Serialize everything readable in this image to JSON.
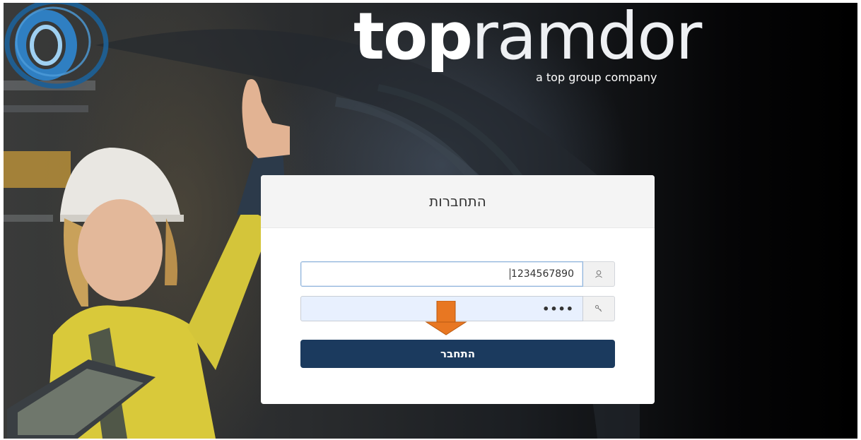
{
  "brand": {
    "name_bold": "top",
    "name_light": "ramdor",
    "tagline": "a top group company",
    "color_primary": "#1b3a5e",
    "color_ring": "#1d5f94"
  },
  "login": {
    "title": "התחברות",
    "username": {
      "value": "1234567890",
      "icon": "user-icon"
    },
    "password": {
      "masked_value": "••••",
      "icon": "key-icon"
    },
    "submit_label": "התחבר",
    "hint_arrow": {
      "icon": "arrow-down-icon",
      "color": "#e87722"
    }
  }
}
